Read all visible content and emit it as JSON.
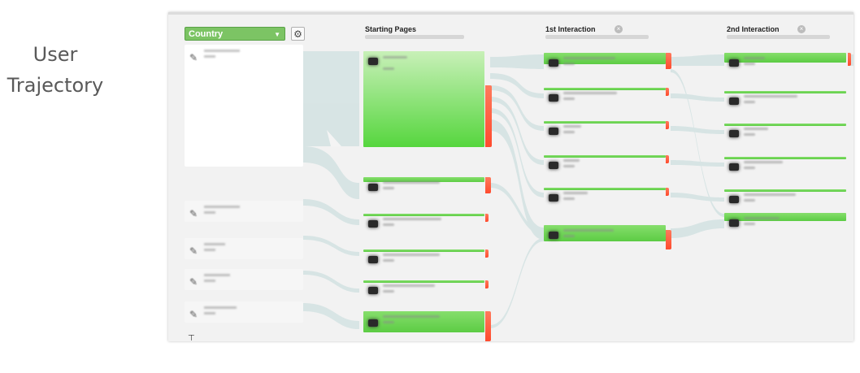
{
  "side_title_line1": "User",
  "side_title_line2": "Trajectory",
  "toolbar": {
    "dimension_select_value": "Country",
    "settings_icon": "gear-icon",
    "dropdown_color": "#7cc464"
  },
  "columns": [
    {
      "label": "Starting Pages"
    },
    {
      "label": "1st Interaction",
      "close_icon": "close-icon"
    },
    {
      "label": "2nd Interaction",
      "close_icon": "close-icon"
    }
  ],
  "colors": {
    "node_green": "#6cd454",
    "drop_off_red": "#ff5a3c",
    "flow": "#cfe0e0"
  }
}
